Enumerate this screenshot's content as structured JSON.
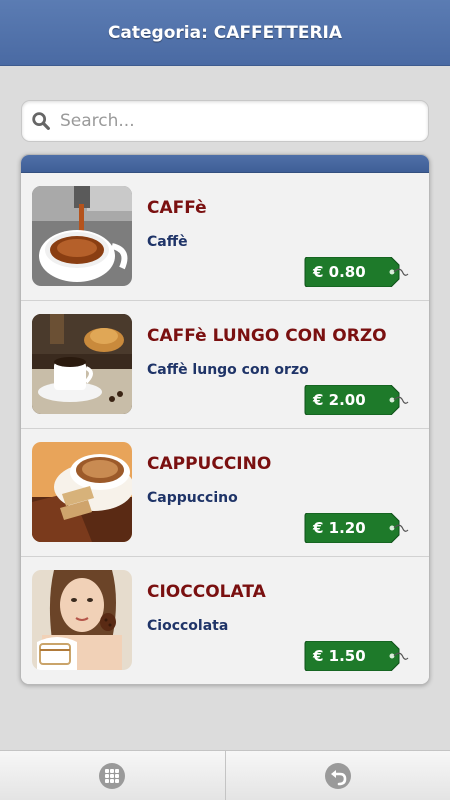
{
  "header": {
    "title": "Categoria: CAFFETTERIA"
  },
  "search": {
    "placeholder": "Search...",
    "value": ""
  },
  "items": [
    {
      "title": "CAFFè",
      "description": "Caffè",
      "price": "€ 0.80",
      "image": "espresso-cup-image"
    },
    {
      "title": "CAFFè LUNGO CON ORZO",
      "description": "Caffè lungo con orzo",
      "price": "€ 2.00",
      "image": "coffee-and-croissant-image"
    },
    {
      "title": "CAPPUCCINO",
      "description": "Cappuccino",
      "price": "€ 1.20",
      "image": "cappuccino-and-biscotti-image"
    },
    {
      "title": "CIOCCOLATA",
      "description": "Cioccolata",
      "price": "€ 1.50",
      "image": "woman-with-chocolate-image"
    }
  ],
  "footer": {
    "buttons": [
      {
        "icon": "grid-icon"
      },
      {
        "icon": "back-arrow-icon"
      }
    ]
  },
  "colors": {
    "header": "#4a6aa3",
    "item_title": "#7a1010",
    "item_description": "#1f3468",
    "price_tag": "#1e7a2a"
  }
}
